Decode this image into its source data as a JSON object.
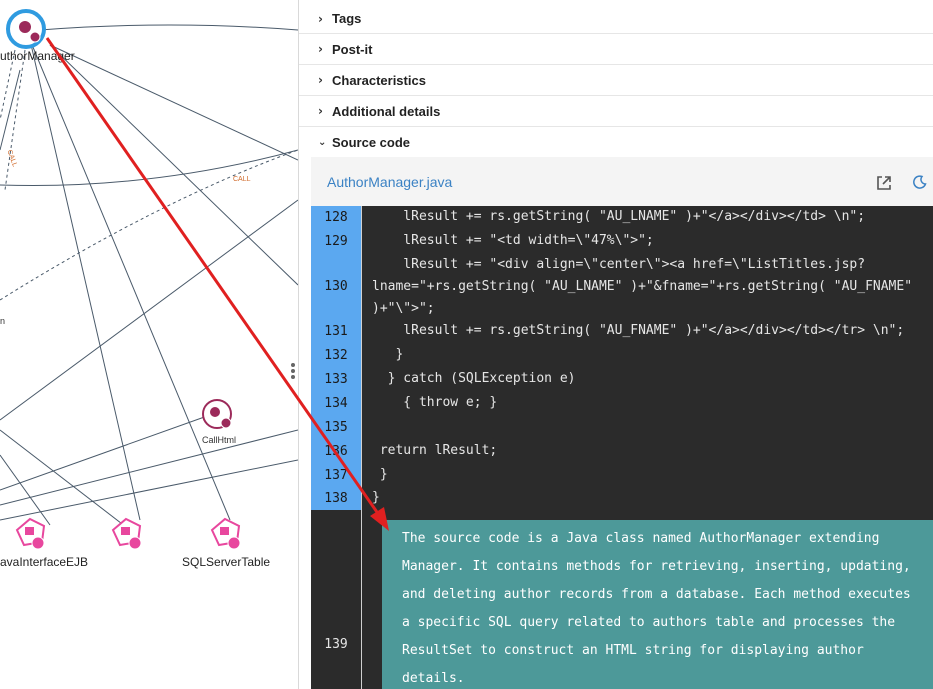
{
  "graph": {
    "nodes": [
      {
        "label": "uthorManager"
      },
      {
        "label": "CallHtml"
      },
      {
        "label": "avaInterfaceEJB"
      },
      {
        "label": "SQLServerTable"
      },
      {
        "label": "n"
      }
    ],
    "annotations": [
      "CALL",
      "CALL"
    ]
  },
  "panel": {
    "sections": [
      {
        "title": "Tags",
        "expanded": false
      },
      {
        "title": "Post-it",
        "expanded": false
      },
      {
        "title": "Characteristics",
        "expanded": false
      },
      {
        "title": "Additional details",
        "expanded": false
      },
      {
        "title": "Source code",
        "expanded": true
      }
    ],
    "chevrons": {
      "collapsed": "›",
      "expanded": "⌄"
    }
  },
  "source": {
    "file_name": "AuthorManager.java",
    "lines": [
      {
        "n": "128",
        "text": "    lResult += rs.getString( \"AU_LNAME\" )+\"</a></div></td> \\n\";"
      },
      {
        "n": "129",
        "text": "    lResult += \"<td width=\\\"47%\\\">\";"
      },
      {
        "n": "130",
        "text": "    lResult += \"<div align=\\\"center\\\"><a href=\\\"ListTitles.jsp?"
      },
      {
        "n": "",
        "text": "lname=\"+rs.getString( \"AU_LNAME\" )+\"&fname=\"+rs.getString( \"AU_FNAME\""
      },
      {
        "n": "",
        "text": ")+\"\\\">\";"
      },
      {
        "n": "131",
        "text": "    lResult += rs.getString( \"AU_FNAME\" )+\"</a></div></td></tr> \\n\";"
      },
      {
        "n": "132",
        "text": "   }"
      },
      {
        "n": "133",
        "text": "  } catch (SQLException e)"
      },
      {
        "n": "134",
        "text": "    { throw e; }"
      },
      {
        "n": "135",
        "text": ""
      },
      {
        "n": "136",
        "text": " return lResult;"
      },
      {
        "n": "137",
        "text": " }"
      },
      {
        "n": "138",
        "text": "}"
      }
    ],
    "ai_line_number": "139",
    "ai_summary": "The source code is a Java class named AuthorManager extending Manager. It contains methods for retrieving, inserting, updating, and deleting author records from a database. Each method executes a specific SQL query related to authors table and processes the ResultSet to construct an HTML string for displaying author details."
  },
  "colors": {
    "gutter_highlight": "#5ba8f0",
    "code_bg": "#2b2b2b",
    "summary_bg": "#4d9999",
    "arrow": "#e02020",
    "link": "#3b82c4",
    "node_ring": "#2f9be0",
    "node_pink": "#e8479e",
    "node_maroon": "#9c2a5a"
  }
}
